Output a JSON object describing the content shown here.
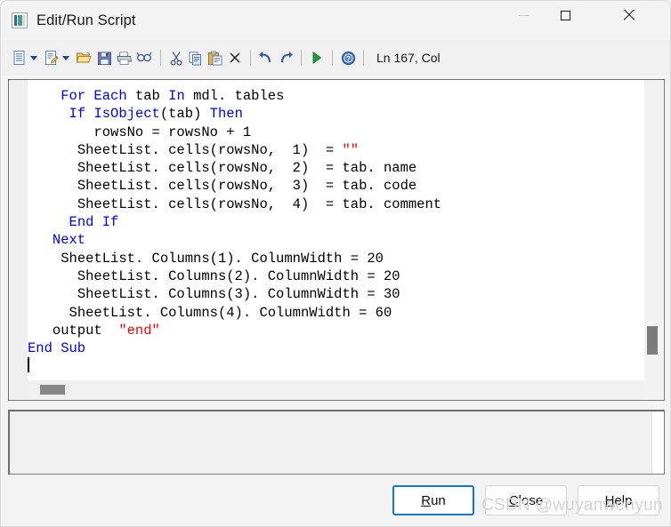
{
  "window": {
    "title": "Edit/Run Script",
    "icon": "script-window-icon",
    "controls": {
      "minimize": "minimize-icon",
      "maximize": "maximize-icon",
      "close": "close-icon"
    }
  },
  "toolbar": {
    "items": [
      {
        "name": "new-script-icon",
        "tooltip": "New",
        "has_dropdown": true
      },
      {
        "name": "edit-script-icon",
        "tooltip": "Edit",
        "has_dropdown": true
      },
      {
        "name": "open-folder-icon",
        "tooltip": "Open",
        "has_dropdown": false
      },
      {
        "name": "save-icon",
        "tooltip": "Save",
        "has_dropdown": false
      },
      {
        "name": "print-icon",
        "tooltip": "Print",
        "has_dropdown": false
      },
      {
        "name": "find-icon",
        "tooltip": "Find",
        "has_dropdown": false
      },
      {
        "name": "cut-icon",
        "tooltip": "Cut",
        "has_dropdown": false
      },
      {
        "name": "copy-icon",
        "tooltip": "Copy",
        "has_dropdown": false
      },
      {
        "name": "paste-icon",
        "tooltip": "Paste",
        "has_dropdown": false
      },
      {
        "name": "delete-icon",
        "tooltip": "Delete",
        "has_dropdown": false
      },
      {
        "name": "undo-icon",
        "tooltip": "Undo",
        "has_dropdown": false
      },
      {
        "name": "redo-icon",
        "tooltip": "Redo",
        "has_dropdown": false
      },
      {
        "name": "run-icon",
        "tooltip": "Run",
        "has_dropdown": false
      },
      {
        "name": "help-icon",
        "tooltip": "Help",
        "has_dropdown": false
      }
    ],
    "status": "Ln 167, Col "
  },
  "editor": {
    "lines": [
      {
        "indent": 4,
        "tokens": [
          {
            "t": "kw",
            "v": "For Each"
          },
          {
            "t": "p",
            "v": " tab "
          },
          {
            "t": "kw",
            "v": "In"
          },
          {
            "t": "p",
            "v": " mdl. tables"
          }
        ]
      },
      {
        "indent": 5,
        "tokens": [
          {
            "t": "kw",
            "v": "If"
          },
          {
            "t": "p",
            "v": " "
          },
          {
            "t": "kw",
            "v": "IsObject"
          },
          {
            "t": "p",
            "v": "(tab) "
          },
          {
            "t": "kw",
            "v": "Then"
          }
        ]
      },
      {
        "indent": 8,
        "tokens": [
          {
            "t": "p",
            "v": "rowsNo = rowsNo + 1"
          }
        ]
      },
      {
        "indent": 6,
        "tokens": [
          {
            "t": "p",
            "v": "SheetList. cells(rowsNo,  1)  = "
          },
          {
            "t": "str",
            "v": "″″"
          }
        ]
      },
      {
        "indent": 6,
        "tokens": [
          {
            "t": "p",
            "v": "SheetList. cells(rowsNo,  2)  = tab. name"
          }
        ]
      },
      {
        "indent": 6,
        "tokens": [
          {
            "t": "p",
            "v": "SheetList. cells(rowsNo,  3)  = tab. code"
          }
        ]
      },
      {
        "indent": 6,
        "tokens": [
          {
            "t": "p",
            "v": "SheetList. cells(rowsNo,  4)  = tab. comment"
          }
        ]
      },
      {
        "indent": 5,
        "tokens": [
          {
            "t": "kw",
            "v": "End If"
          }
        ]
      },
      {
        "indent": 3,
        "tokens": [
          {
            "t": "kw",
            "v": "Next"
          }
        ]
      },
      {
        "indent": 4,
        "tokens": [
          {
            "t": "p",
            "v": "SheetList. Columns(1). ColumnWidth = 20"
          }
        ]
      },
      {
        "indent": 6,
        "tokens": [
          {
            "t": "p",
            "v": "SheetList. Columns(2). ColumnWidth = 20"
          }
        ]
      },
      {
        "indent": 6,
        "tokens": [
          {
            "t": "p",
            "v": "SheetList. Columns(3). ColumnWidth = 30"
          }
        ]
      },
      {
        "indent": 5,
        "tokens": [
          {
            "t": "p",
            "v": "SheetList. Columns(4). ColumnWidth = 60"
          }
        ]
      },
      {
        "indent": 3,
        "tokens": [
          {
            "t": "p",
            "v": "output  "
          },
          {
            "t": "str",
            "v": "″end″"
          }
        ]
      },
      {
        "indent": 0,
        "tokens": [
          {
            "t": "kw",
            "v": "End Sub"
          }
        ]
      },
      {
        "indent": 0,
        "tokens": [
          {
            "t": "caret",
            "v": ""
          }
        ]
      }
    ],
    "colors": {
      "keyword": "#0000ff",
      "string": "#ff0000",
      "plain": "#000000",
      "background": "#ffffff",
      "gutter": "#efefef"
    },
    "scroll": {
      "vertical_thumb_position": "near-bottom",
      "horizontal_thumb_position": "left"
    }
  },
  "output": {
    "text": ""
  },
  "buttons": {
    "run": {
      "label": "Run",
      "mnemonic": "R",
      "rest": "un",
      "primary": true
    },
    "close": {
      "label": "Close",
      "mnemonic": "C",
      "rest": "lose",
      "primary": false
    },
    "help": {
      "label": "Help",
      "mnemonic": "H",
      "rest": "elp",
      "primary": false
    }
  },
  "watermark": "CSDN @wuyanwenyun"
}
